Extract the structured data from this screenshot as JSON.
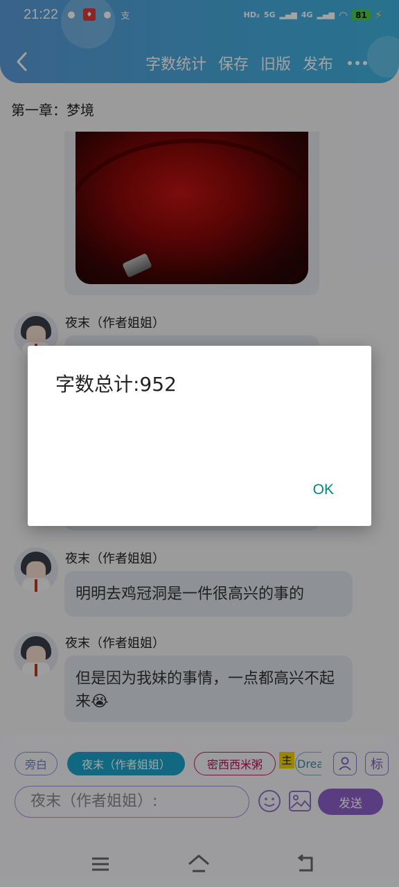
{
  "status_bar": {
    "time": "21:22",
    "net_a": "HD₂",
    "net_b": "5G",
    "net_c": "4G",
    "battery": "81"
  },
  "header": {
    "actions": [
      "字数统计",
      "保存",
      "旧版",
      "发布"
    ]
  },
  "chapter_title": "第一章：梦境",
  "messages": [
    {
      "sender": "夜末（作者姐姐）",
      "text": ""
    },
    {
      "sender": "夜末（作者姐姐）",
      "text": "明明去鸡冠洞是一件很高兴的事的"
    },
    {
      "sender": "夜末（作者姐姐）",
      "text": "但是因为我妹的事情，一点都高兴不起来😭"
    }
  ],
  "input_panel": {
    "roles": {
      "narration": "旁白",
      "active": "夜末（作者姐姐）",
      "role2": "密西西米粥",
      "tag": "主",
      "role3": "Drea"
    },
    "mark_button": "标",
    "input_value": "夜末（作者姐姐）:",
    "send_label": "发送"
  },
  "dialog": {
    "message": "字数总计:952",
    "ok_label": "OK"
  },
  "colors": {
    "header_accent": "#4aa8dc",
    "active_role": "#1aa5c9",
    "send_button": "#8d5fc8",
    "dialog_ok": "#00897b"
  }
}
